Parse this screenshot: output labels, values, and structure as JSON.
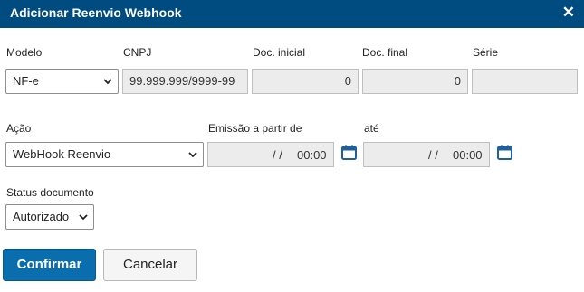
{
  "dialog": {
    "title": "Adicionar Reenvio Webhook",
    "close_glyph": "✕"
  },
  "labels": {
    "modelo": "Modelo",
    "cnpj": "CNPJ",
    "doc_inicial": "Doc. inicial",
    "doc_final": "Doc. final",
    "serie": "Série",
    "acao": "Ação",
    "emissao": "Emissão a partir de",
    "ate": "até",
    "status": "Status documento"
  },
  "fields": {
    "modelo": "NF-e",
    "cnpj": "99.999.999/9999-99",
    "doc_inicial": "0",
    "doc_final": "0",
    "serie": "",
    "acao": "WebHook Reenvio",
    "emissao_date": "/ /",
    "emissao_time": "00:00",
    "ate_date": "/ /",
    "ate_time": "00:00",
    "status": "Autorizado"
  },
  "buttons": {
    "confirm": "Confirmar",
    "cancel": "Cancelar"
  },
  "icons": {
    "close": "close-icon",
    "calendar": "calendar-icon",
    "dropdown": "chevron-down-icon"
  },
  "colors": {
    "header": "#004b80",
    "primary": "#0a6dad",
    "field_bg": "#ececec",
    "calendar": "#1f5f9e"
  }
}
